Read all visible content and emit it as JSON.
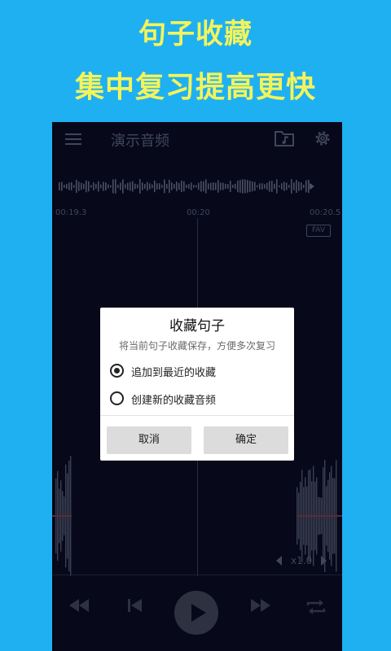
{
  "promo": {
    "headline1": "句子收藏",
    "headline2": "集中复习提高更快"
  },
  "app": {
    "title": "演示音频",
    "icons": [
      "menu-icon",
      "music-folder-icon",
      "gear-icon"
    ]
  },
  "timeline": {
    "start": "00:19.3",
    "mid": "00:20",
    "end": "00:20.5",
    "fav": "FAV"
  },
  "speed": {
    "label": "x1.0"
  },
  "controls": [
    "rewind-icon",
    "previous-icon",
    "play-icon",
    "fast-forward-icon",
    "repeat-icon"
  ],
  "dialog": {
    "title": "收藏句子",
    "subtitle": "将当前句子收藏保存，方便多次复习",
    "options": [
      {
        "label": "追加到最近的收藏",
        "selected": true
      },
      {
        "label": "创建新的收藏音频",
        "selected": false
      }
    ],
    "cancel": "取消",
    "confirm": "确定"
  },
  "colors": {
    "background": "#1FB0F2",
    "headline": "#F4F45A",
    "app_bg": "#07081A",
    "dim": "#3E4758"
  }
}
